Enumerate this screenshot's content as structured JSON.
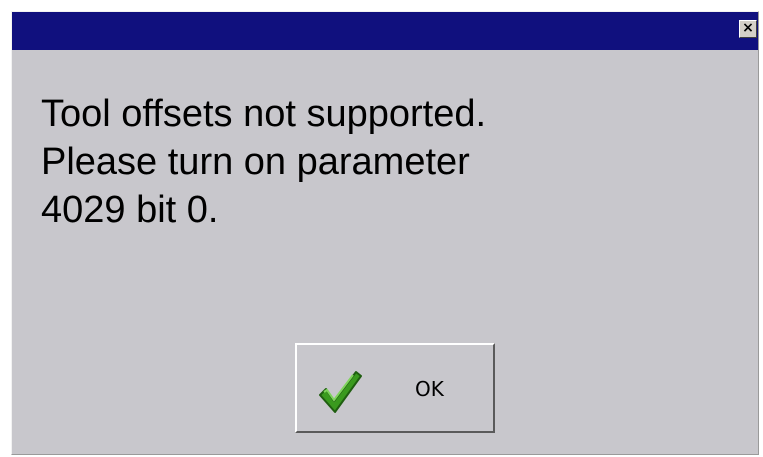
{
  "dialog": {
    "close_glyph": "×",
    "message_lines": [
      "Tool offsets not supported.",
      "Please turn on parameter",
      "4029 bit 0."
    ],
    "ok_button": {
      "label": "OK",
      "icon": "checkmark-icon",
      "icon_color": "#3a9a1e"
    }
  },
  "colors": {
    "titlebar": "#10107e",
    "dialog_background": "#c8c7cc"
  }
}
